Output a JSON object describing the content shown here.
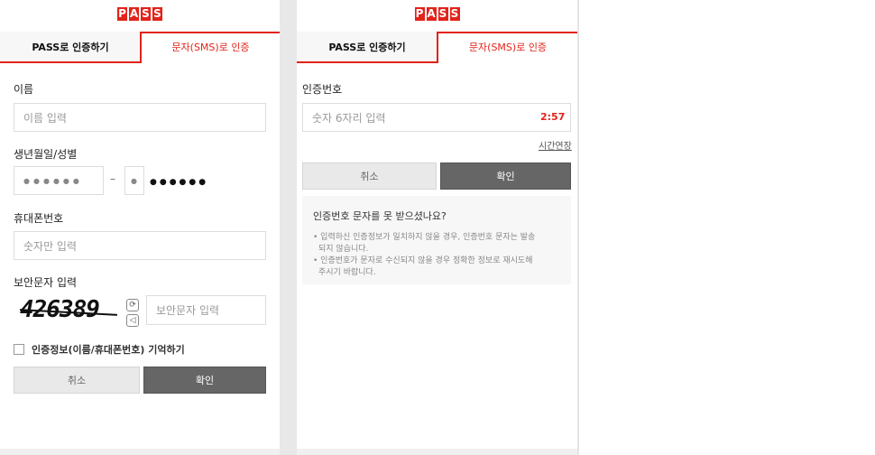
{
  "logo_letters": [
    "P",
    "A",
    "S",
    "S"
  ],
  "tabs": {
    "pass": "PASS로 인증하기",
    "sms": "문자(SMS)로 인증"
  },
  "form": {
    "name_label": "이름",
    "name_placeholder": "이름 입력",
    "birth_label": "생년월일/성별",
    "birth_masked": "●●●●●●",
    "dash": "–",
    "gender_masked": "●",
    "rest_masked": "●●●●●●",
    "phone_label": "휴대폰번호",
    "phone_placeholder": "숫자만 입력",
    "captcha_label": "보안문자 입력",
    "captcha_text": "426389",
    "captcha_placeholder": "보안문자 입력",
    "remember_label": "인증정보(이름/휴대폰번호) 기억하기",
    "cancel": "취소",
    "confirm": "확인"
  },
  "verify": {
    "code_label": "인증번호",
    "code_placeholder": "숫자 6자리 입력",
    "timer": "2:57",
    "extend": "시간연장",
    "cancel": "취소",
    "confirm": "확인",
    "help_title": "인증번호 문자를 못 받으셨나요?",
    "help_line1a": "• 입력하신 인증정보가 일치하지 않을 경우, 인증번호 문자는 발송",
    "help_line1b": "되지 않습니다.",
    "help_line2a": "• 인증번호가 문자로 수신되지 않을 경우 정확한 정보로 재시도해",
    "help_line2b": "주시기 바랍니다."
  },
  "colors": {
    "brand": "#e2231a",
    "button_dark": "#666666",
    "button_light": "#e9e9e9"
  }
}
